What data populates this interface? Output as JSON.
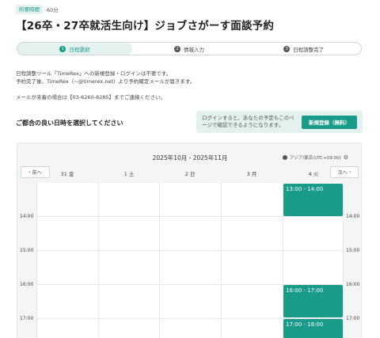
{
  "duration": {
    "label": "所要時間",
    "value": "60分"
  },
  "title": "【26卒・27卒就活生向け】ジョブさがーす面談予約",
  "steps": [
    {
      "num": "1",
      "label": "日程選択"
    },
    {
      "num": "2",
      "label": "情報入力"
    },
    {
      "num": "3",
      "label": "日程調整完了"
    }
  ],
  "info": {
    "line1": "日程調整ツール「TimeRex」への新規登録・ログインは不要です。",
    "line2": "予約完了後、TimeRex（~@timerex.net）より予約確定メールが届きます。",
    "line3": "メールが未着の場合は【03-6260-8285】までご連絡ください。"
  },
  "select_label": "ご都合の良い日時を選択してください",
  "login": {
    "text": "ログインすると、あなたの予定もこのページで確認できるようになります。",
    "button": "新規登録（無料）"
  },
  "calendar": {
    "range": "2025年10月 - 2025年11月",
    "timezone": "アジア/東京(UTC+09:00)",
    "prev": "前へ",
    "next": "次へ",
    "days": [
      "31 金",
      "1 土",
      "2 日",
      "3 月",
      "4 火"
    ],
    "times": [
      "14:00",
      "15:00",
      "16:00",
      "17:00"
    ],
    "slots": [
      "13:00 - 14:00",
      "16:00 - 17:00",
      "17:00 - 18:00"
    ]
  },
  "colors": {
    "accent": "#1a9a89",
    "accent_light": "#e3f1ef"
  }
}
